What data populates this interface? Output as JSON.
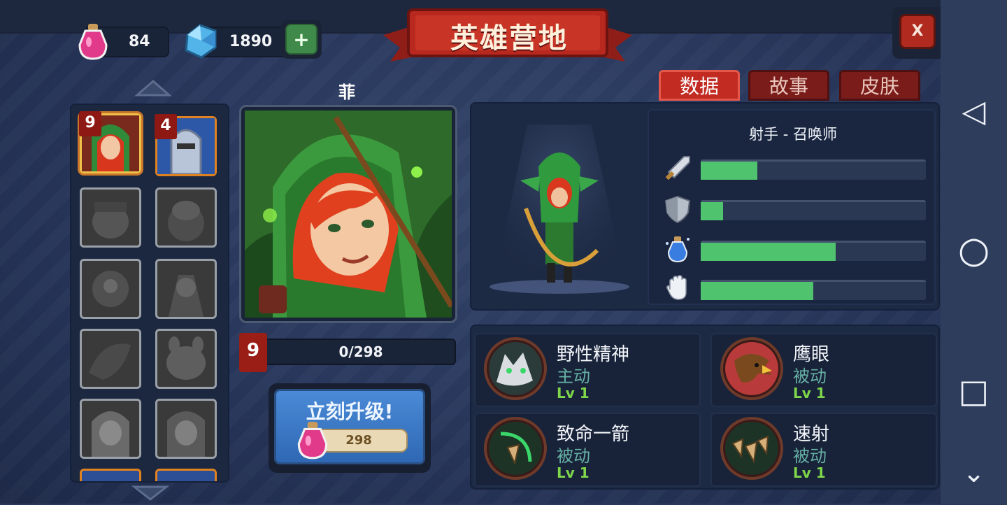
{
  "header": {
    "title": "英雄营地",
    "potion_count": "84",
    "gem_count": "1890",
    "add_label": "+",
    "close_label": "X"
  },
  "roster": {
    "slots": [
      {
        "level": "9",
        "state": "selected"
      },
      {
        "level": "4",
        "state": "owned"
      },
      {
        "state": "locked"
      },
      {
        "state": "locked"
      },
      {
        "state": "locked"
      },
      {
        "state": "locked"
      },
      {
        "state": "locked"
      },
      {
        "state": "locked"
      },
      {
        "state": "locked"
      },
      {
        "state": "locked"
      }
    ]
  },
  "hero": {
    "name": "菲",
    "level": "9",
    "xp_text": "0/298",
    "upgrade_label": "立刻升级!",
    "upgrade_cost": "298"
  },
  "tabs": [
    {
      "label": "数据",
      "active": true
    },
    {
      "label": "故事",
      "active": false
    },
    {
      "label": "皮肤",
      "active": false
    }
  ],
  "stats": {
    "class_label": "射手 - 召唤师",
    "bars": [
      {
        "icon": "sword-icon",
        "fraction": 0.25
      },
      {
        "icon": "shield-icon",
        "fraction": 0.1
      },
      {
        "icon": "potion-icon",
        "fraction": 0.6
      },
      {
        "icon": "hand-icon",
        "fraction": 0.5
      }
    ]
  },
  "skills": [
    {
      "name": "野性精神",
      "type": "主动",
      "level": "Lv 1",
      "icon": "wolf-icon"
    },
    {
      "name": "鹰眼",
      "type": "被动",
      "level": "Lv 1",
      "icon": "eagle-icon"
    },
    {
      "name": "致命一箭",
      "type": "被动",
      "level": "Lv 1",
      "icon": "arrow-icon"
    },
    {
      "name": "速射",
      "type": "被动",
      "level": "Lv 1",
      "icon": "multi-arrow-icon"
    }
  ],
  "navigation": {
    "back": "◁",
    "home": "○",
    "recents": "□",
    "collapse": "⌄"
  }
}
